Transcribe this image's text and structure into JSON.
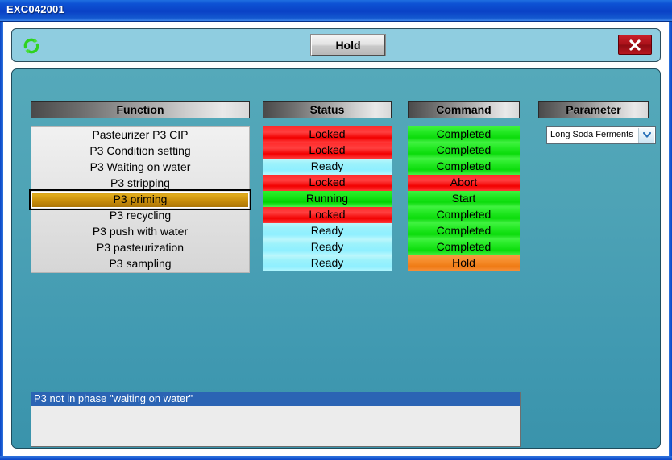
{
  "window": {
    "title": "EXC042001"
  },
  "toolbar": {
    "refresh_icon": "refresh-icon",
    "hold_label": "Hold",
    "close_icon": "close-icon"
  },
  "columns": {
    "function": "Function",
    "status": "Status",
    "command": "Command",
    "parameter": "Parameter"
  },
  "rows": [
    {
      "function": "Pasteurizer P3 CIP",
      "status": "Locked",
      "status_state": "locked",
      "command": "Completed",
      "command_state": "completed",
      "selected": false
    },
    {
      "function": "P3 Condition setting",
      "status": "Locked",
      "status_state": "locked",
      "command": "Completed",
      "command_state": "completed",
      "selected": false
    },
    {
      "function": "P3 Waiting on water",
      "status": "Ready",
      "status_state": "ready",
      "command": "Completed",
      "command_state": "completed",
      "selected": false
    },
    {
      "function": "P3 stripping",
      "status": "Locked",
      "status_state": "locked",
      "command": "Abort",
      "command_state": "abort",
      "selected": false
    },
    {
      "function": "P3 priming",
      "status": "Running",
      "status_state": "running",
      "command": "Start",
      "command_state": "start",
      "selected": true
    },
    {
      "function": "P3 recycling",
      "status": "Locked",
      "status_state": "locked",
      "command": "Completed",
      "command_state": "completed",
      "selected": false
    },
    {
      "function": "P3 push with water",
      "status": "Ready",
      "status_state": "ready",
      "command": "Completed",
      "command_state": "completed",
      "selected": false
    },
    {
      "function": "P3 pasteurization",
      "status": "Ready",
      "status_state": "ready",
      "command": "Completed",
      "command_state": "completed",
      "selected": false
    },
    {
      "function": "P3 sampling",
      "status": "Ready",
      "status_state": "ready",
      "command": "Hold",
      "command_state": "hold",
      "selected": false
    }
  ],
  "parameter": {
    "selected": "Long Soda Ferments",
    "dropdown_icon": "chevron-down-icon"
  },
  "messages": [
    {
      "text": "P3 not in phase \"waiting on water\"",
      "selected": true
    }
  ],
  "colors": {
    "title_bar": "#0a46c8",
    "toolbar": "#8fcde0",
    "panel": "#4ea3b6",
    "locked": "#ff2b2b",
    "ready": "#9cf2fb",
    "running": "#19e319",
    "completed": "#22e822",
    "abort": "#ff2b2b",
    "hold": "#f58a28",
    "selected_row": "#c98e0b",
    "message_selected": "#2b64b4"
  }
}
